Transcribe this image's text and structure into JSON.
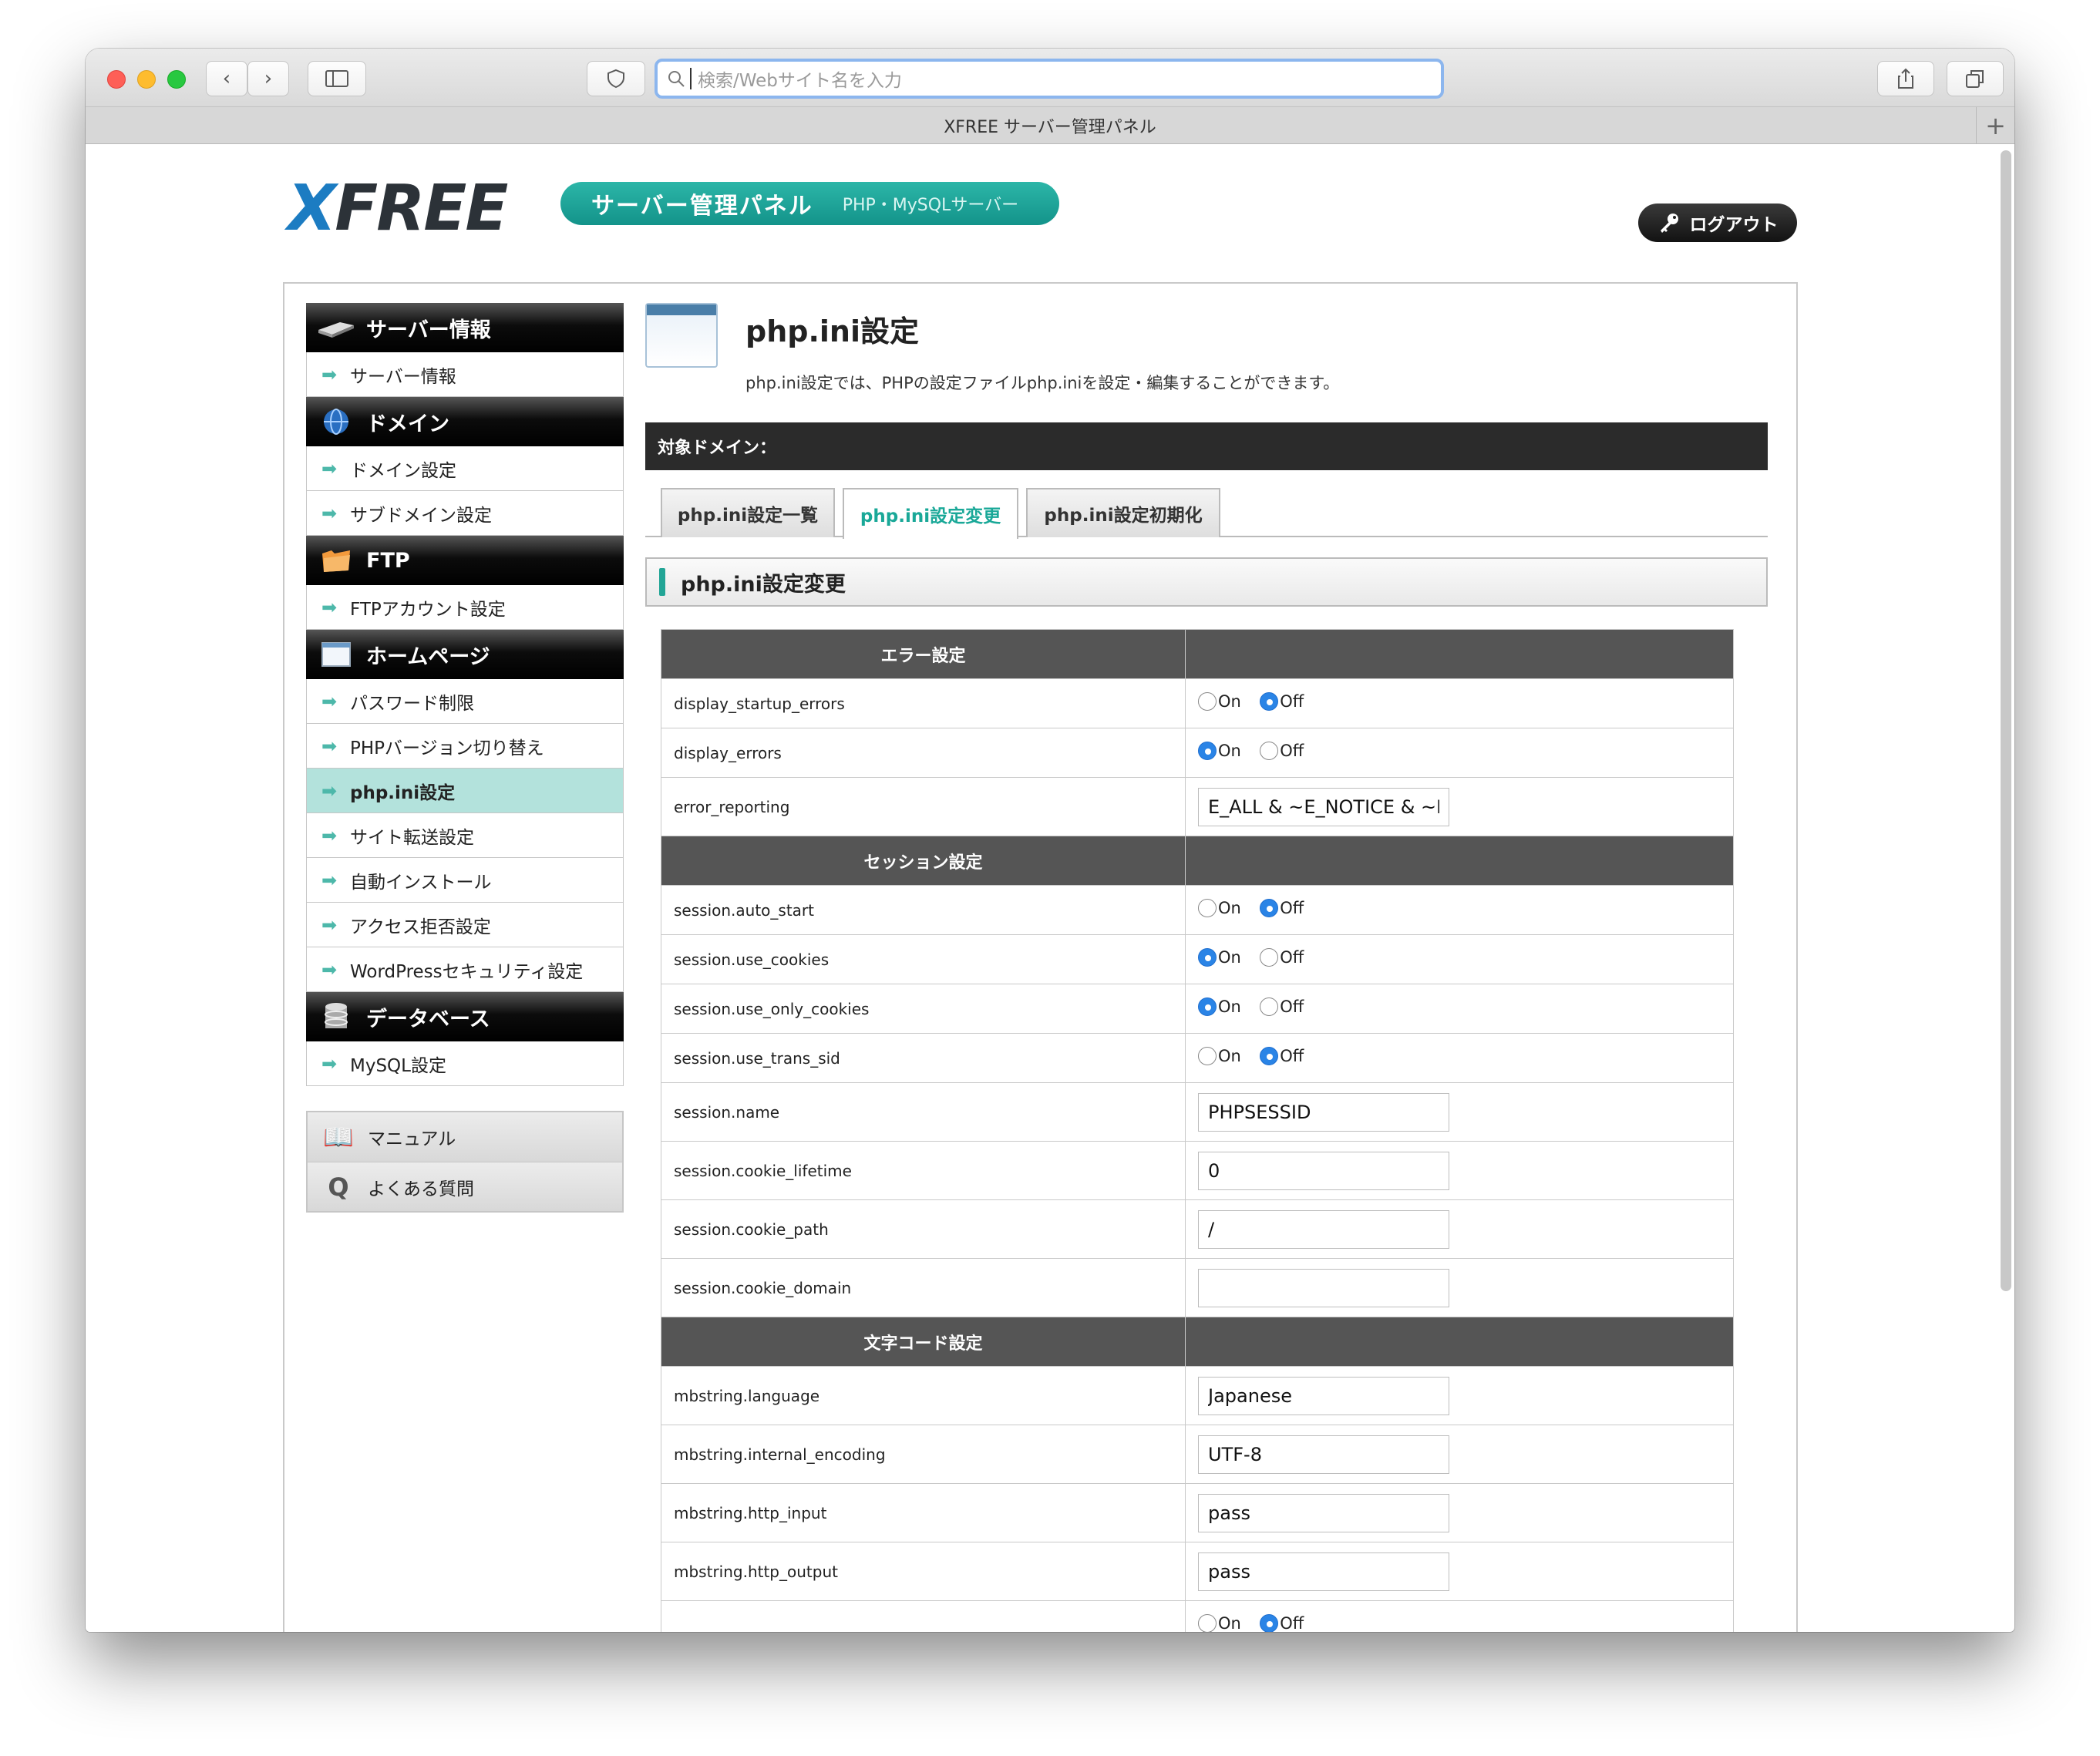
{
  "browser": {
    "address_placeholder": "検索/Webサイト名を入力",
    "tab_title": "XFREE サーバー管理パネル"
  },
  "header": {
    "logo_x": "X",
    "logo_rest": "FREE",
    "banner_title": "サーバー管理パネル",
    "banner_sub": "PHP・MySQLサーバー",
    "logout_label": "ログアウト"
  },
  "sidebar": {
    "groups": [
      {
        "title": "サーバー情報",
        "icon": "server-icon",
        "items": [
          {
            "label": "サーバー情報"
          }
        ]
      },
      {
        "title": "ドメイン",
        "icon": "globe-icon",
        "items": [
          {
            "label": "ドメイン設定"
          },
          {
            "label": "サブドメイン設定"
          }
        ]
      },
      {
        "title": "FTP",
        "icon": "folder-icon",
        "items": [
          {
            "label": "FTPアカウント設定"
          }
        ]
      },
      {
        "title": "ホームページ",
        "icon": "window-icon",
        "items": [
          {
            "label": "パスワード制限"
          },
          {
            "label": "PHPバージョン切り替え"
          },
          {
            "label": "php.ini設定"
          },
          {
            "label": "サイト転送設定"
          },
          {
            "label": "自動インストール"
          },
          {
            "label": "アクセス拒否設定"
          },
          {
            "label": "WordPressセキュリティ設定"
          }
        ]
      },
      {
        "title": "データベース",
        "icon": "database-icon",
        "items": [
          {
            "label": "MySQL設定"
          }
        ]
      }
    ],
    "extras": [
      {
        "label": "マニュアル",
        "icon": "book-icon"
      },
      {
        "label": "よくある質問",
        "icon": "q-icon"
      }
    ]
  },
  "main": {
    "title": "php.ini設定",
    "description": "php.ini設定では、PHPの設定ファイルphp.iniを設定・編集することができます。",
    "domain_label": "対象ドメイン：",
    "tabs": [
      {
        "label": "php.ini設定一覧"
      },
      {
        "label": "php.ini設定変更"
      },
      {
        "label": "php.ini設定初期化"
      }
    ],
    "section_title": "php.ini設定変更",
    "on_label": "On",
    "off_label": "Off",
    "groups": {
      "error": "エラー設定",
      "session": "セッション設定",
      "charset": "文字コード設定"
    },
    "rows": {
      "display_startup_errors": {
        "name": "display_startup_errors",
        "value": "Off"
      },
      "display_errors": {
        "name": "display_errors",
        "value": "On"
      },
      "error_reporting": {
        "name": "error_reporting",
        "value": "E_ALL & ~E_NOTICE & ~E_S"
      },
      "session_auto_start": {
        "name": "session.auto_start",
        "value": "Off"
      },
      "session_use_cookies": {
        "name": "session.use_cookies",
        "value": "On"
      },
      "session_use_only_cookies": {
        "name": "session.use_only_cookies",
        "value": "On"
      },
      "session_use_trans_sid": {
        "name": "session.use_trans_sid",
        "value": "Off"
      },
      "session_name": {
        "name": "session.name",
        "value": "PHPSESSID"
      },
      "session_cookie_lifetime": {
        "name": "session.cookie_lifetime",
        "value": "0"
      },
      "session_cookie_path": {
        "name": "session.cookie_path",
        "value": "/"
      },
      "session_cookie_domain": {
        "name": "session.cookie_domain",
        "value": ""
      },
      "mbstring_language": {
        "name": "mbstring.language",
        "value": "Japanese"
      },
      "mbstring_internal_encoding": {
        "name": "mbstring.internal_encoding",
        "value": "UTF-8"
      },
      "mbstring_http_input": {
        "name": "mbstring.http_input",
        "value": "pass"
      },
      "mbstring_http_output": {
        "name": "mbstring.http_output",
        "value": "pass"
      }
    }
  }
}
